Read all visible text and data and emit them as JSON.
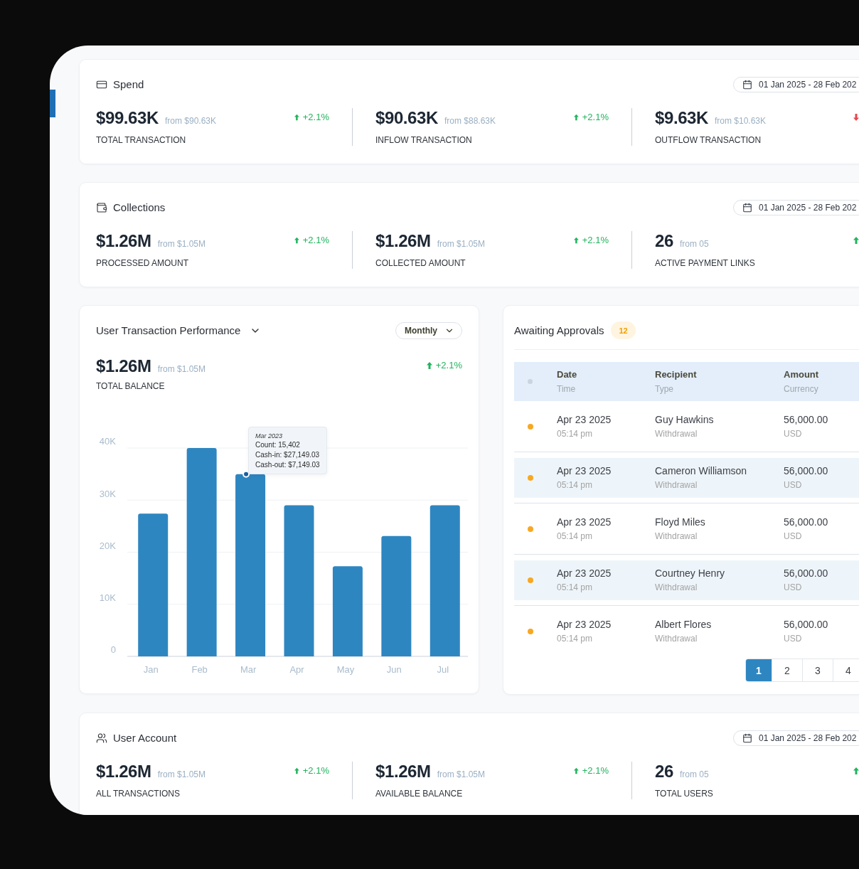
{
  "spend": {
    "title": "Spend",
    "date_range": "01 Jan 2025 - 28 Feb 202",
    "stats": [
      {
        "value": "$99.63K",
        "from": "from $90.63K",
        "label": "TOTAL TRANSACTION",
        "rising": true,
        "change": "+2.1%"
      },
      {
        "value": "$90.63K",
        "from": "from $88.63K",
        "label": "INFLOW TRANSACTION",
        "rising": true,
        "change": "+2.1%"
      },
      {
        "value": "$9.63K",
        "from": "from $10.63K",
        "label": "OUTFLOW TRANSACTION",
        "rising": false
      }
    ]
  },
  "collections": {
    "title": "Collections",
    "date_range": "01 Jan 2025 - 28 Feb 202",
    "stats": [
      {
        "value": "$1.26M",
        "from": "from $1.05M",
        "label": "PROCESSED AMOUNT",
        "rising": true,
        "change": "+2.1%"
      },
      {
        "value": "$1.26M",
        "from": "from $1.05M",
        "label": "COLLECTED AMOUNT",
        "rising": true,
        "change": "+2.1%"
      },
      {
        "value": "26",
        "from": "from 05",
        "label": "ACTIVE PAYMENT LINKS",
        "rising": true
      }
    ]
  },
  "performance": {
    "title": "User Transaction Performance",
    "period": "Monthly",
    "value": "$1.26M",
    "from": "from $1.05M",
    "label": "TOTAL BALANCE",
    "rising": true,
    "change": "+2.1%",
    "chart_data": {
      "type": "bar",
      "categories": [
        "Jan",
        "Feb",
        "Mar",
        "Apr",
        "May",
        "Jun",
        "Jul"
      ],
      "values": [
        27400,
        40000,
        35000,
        29000,
        17300,
        23100,
        29000
      ],
      "ylim": [
        0,
        40000
      ],
      "yticks": [
        {
          "value": 0,
          "label": "0"
        },
        {
          "value": 10000,
          "label": "10K"
        },
        {
          "value": 20000,
          "label": "20K"
        },
        {
          "value": 30000,
          "label": "30K"
        },
        {
          "value": 40000,
          "label": "40K"
        }
      ],
      "grid": true
    },
    "bars": [
      {
        "hovered": false
      },
      {
        "hovered": false
      },
      {
        "hovered": true
      },
      {
        "hovered": false
      },
      {
        "hovered": false
      },
      {
        "hovered": false
      },
      {
        "hovered": false
      }
    ],
    "tooltip": {
      "title": "Mar 2023",
      "lines": [
        "Count: 15,402",
        "Cash-in: $27,149.03",
        "Cash-out: $7,149.03"
      ]
    }
  },
  "approvals": {
    "title": "Awaiting Approvals",
    "count": "12",
    "columns": [
      {
        "title": "Date",
        "subtitle": "Time"
      },
      {
        "title": "Recipient",
        "subtitle": "Type"
      },
      {
        "title": "Amount",
        "subtitle": "Currency"
      }
    ],
    "rows": [
      {
        "date": "Apr 23 2025",
        "time": "05:14 pm",
        "recipient": "Guy Hawkins",
        "type": "Withdrawal",
        "amount": "56,000.00",
        "currency": "USD"
      },
      {
        "date": "Apr 23 2025",
        "time": "05:14 pm",
        "recipient": "Cameron Williamson",
        "type": "Withdrawal",
        "amount": "56,000.00",
        "currency": "USD"
      },
      {
        "date": "Apr 23 2025",
        "time": "05:14 pm",
        "recipient": "Floyd Miles",
        "type": "Withdrawal",
        "amount": "56,000.00",
        "currency": "USD"
      },
      {
        "date": "Apr 23 2025",
        "time": "05:14 pm",
        "recipient": "Courtney Henry",
        "type": "Withdrawal",
        "amount": "56,000.00",
        "currency": "USD"
      },
      {
        "date": "Apr 23 2025",
        "time": "05:14 pm",
        "recipient": "Albert Flores",
        "type": "Withdrawal",
        "amount": "56,000.00",
        "currency": "USD"
      }
    ],
    "pages": [
      {
        "label": "1",
        "selected": true
      },
      {
        "label": "2",
        "selected": false
      },
      {
        "label": "3",
        "selected": false
      },
      {
        "label": "4",
        "selected": false
      }
    ]
  },
  "user_account": {
    "title": "User Account",
    "date_range": "01 Jan 2025 - 28 Feb 202",
    "stats": [
      {
        "value": "$1.26M",
        "from": "from $1.05M",
        "label": "ALL TRANSACTIONS",
        "rising": true,
        "change": "+2.1%"
      },
      {
        "value": "$1.26M",
        "from": "from $1.05M",
        "label": "AVAILABLE BALANCE",
        "rising": true,
        "change": "+2.1%"
      },
      {
        "value": "26",
        "from": "from 05",
        "label": "TOTAL USERS",
        "rising": true
      }
    ]
  }
}
